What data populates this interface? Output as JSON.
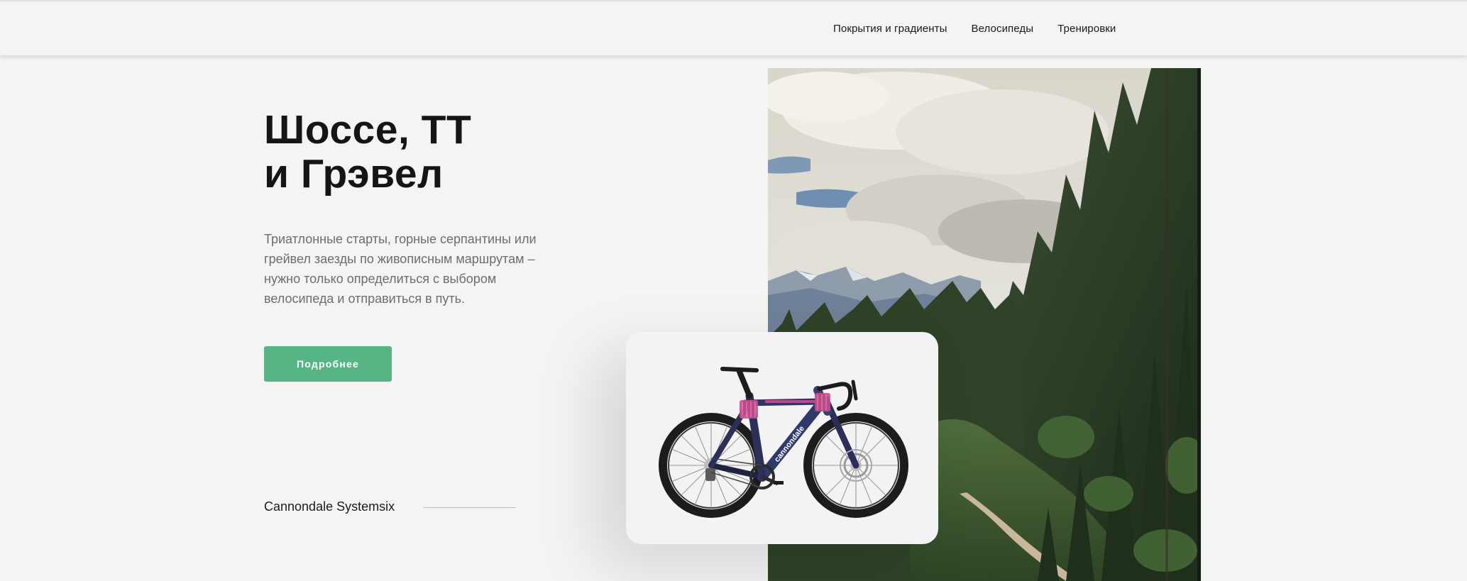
{
  "nav": {
    "items": [
      {
        "label": "Покрытия и градиенты"
      },
      {
        "label": "Велосипеды"
      },
      {
        "label": "Тренировки"
      }
    ]
  },
  "hero": {
    "title_line1": "Шоссе, ТТ",
    "title_line2": "и Грэвел",
    "description": "Триатлонные старты, горные серпантины или грейвел заезды по живописным маршрутам – нужно только определиться с выбором велосипеда и отправиться в путь.",
    "button_label": "Подробнее",
    "model_name": "Cannondale Systemsix"
  },
  "bike": {
    "brand_text": "cannondale"
  },
  "colors": {
    "accent": "#57b585",
    "background": "#f4f4f4",
    "title": "#151515",
    "text_muted": "#6d6d6d"
  }
}
